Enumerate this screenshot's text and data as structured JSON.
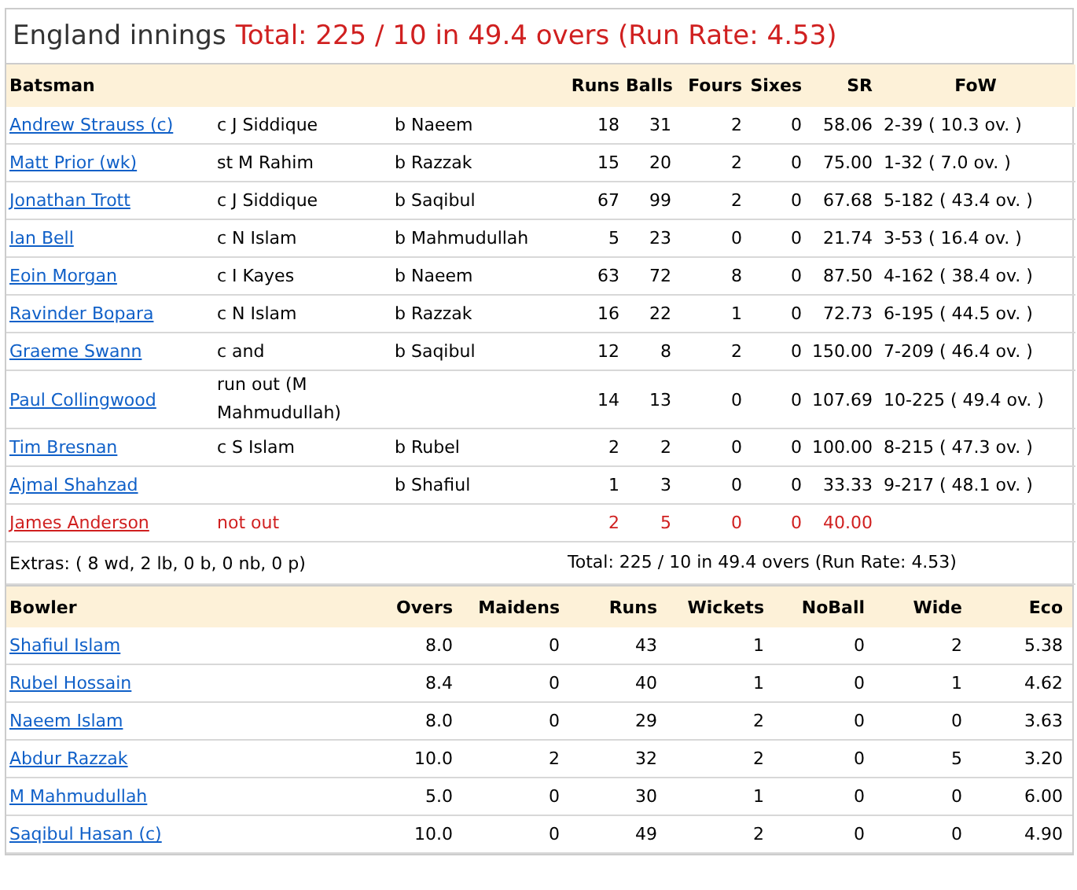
{
  "innings": {
    "team": "England innings",
    "total": "Total: 225 / 10 in 49.4 overs (Run Rate: 4.53)"
  },
  "batting": {
    "columns": [
      "Batsman",
      "Runs",
      "Balls",
      "Fours",
      "Sixes",
      "SR",
      "FoW"
    ],
    "rows": [
      {
        "name": "Andrew Strauss (c)",
        "dismissal": "c J Siddique",
        "bowler": "b Naeem",
        "runs": "18",
        "balls": "31",
        "fours": "2",
        "sixes": "0",
        "sr": "58.06",
        "fow": "2-39 ( 10.3 ov. )",
        "not_out": false
      },
      {
        "name": "Matt Prior (wk)",
        "dismissal": "st M Rahim",
        "bowler": "b Razzak",
        "runs": "15",
        "balls": "20",
        "fours": "2",
        "sixes": "0",
        "sr": "75.00",
        "fow": "1-32 ( 7.0 ov. )",
        "not_out": false
      },
      {
        "name": "Jonathan Trott",
        "dismissal": "c J Siddique",
        "bowler": "b Saqibul",
        "runs": "67",
        "balls": "99",
        "fours": "2",
        "sixes": "0",
        "sr": "67.68",
        "fow": "5-182 ( 43.4 ov. )",
        "not_out": false
      },
      {
        "name": "Ian Bell",
        "dismissal": "c N Islam",
        "bowler": "b Mahmudullah",
        "runs": "5",
        "balls": "23",
        "fours": "0",
        "sixes": "0",
        "sr": "21.74",
        "fow": "3-53 ( 16.4 ov. )",
        "not_out": false
      },
      {
        "name": "Eoin Morgan",
        "dismissal": "c I Kayes",
        "bowler": "b Naeem",
        "runs": "63",
        "balls": "72",
        "fours": "8",
        "sixes": "0",
        "sr": "87.50",
        "fow": "4-162 ( 38.4 ov. )",
        "not_out": false
      },
      {
        "name": "Ravinder Bopara",
        "dismissal": "c N Islam",
        "bowler": "b Razzak",
        "runs": "16",
        "balls": "22",
        "fours": "1",
        "sixes": "0",
        "sr": "72.73",
        "fow": "6-195 ( 44.5 ov. )",
        "not_out": false
      },
      {
        "name": "Graeme Swann",
        "dismissal": "c and",
        "bowler": "b Saqibul",
        "runs": "12",
        "balls": "8",
        "fours": "2",
        "sixes": "0",
        "sr": "150.00",
        "fow": "7-209 ( 46.4 ov. )",
        "not_out": false
      },
      {
        "name": "Paul Collingwood",
        "dismissal": "run out (M Mahmudullah)",
        "runs": "14",
        "balls": "13",
        "fours": "0",
        "sixes": "0",
        "sr": "107.69",
        "fow": "10-225 ( 49.4 ov. )",
        "not_out": false
      },
      {
        "name": "Tim Bresnan",
        "dismissal": "c S Islam",
        "bowler": "b Rubel",
        "runs": "2",
        "balls": "2",
        "fours": "0",
        "sixes": "0",
        "sr": "100.00",
        "fow": "8-215 ( 47.3 ov. )",
        "not_out": false
      },
      {
        "name": "Ajmal Shahzad",
        "bowler": "b Shafiul",
        "runs": "1",
        "balls": "3",
        "fours": "0",
        "sixes": "0",
        "sr": "33.33",
        "fow": "9-217 ( 48.1 ov. )",
        "not_out": false
      },
      {
        "name": "James Anderson",
        "dismissal": "not out",
        "runs": "2",
        "balls": "5",
        "fours": "0",
        "sixes": "0",
        "sr": "40.00",
        "not_out": true
      }
    ],
    "extras": "Extras: ( 8 wd, 2 lb, 0 b, 0 nb, 0 p)",
    "total": "Total: 225 / 10 in 49.4 overs (Run Rate: 4.53)"
  },
  "bowling": {
    "columns": [
      "Bowler",
      "Overs",
      "Maidens",
      "Runs",
      "Wickets",
      "NoBall",
      "Wide",
      "Eco"
    ],
    "rows": [
      [
        "Shafiul Islam",
        "8.0",
        "0",
        "43",
        "1",
        "0",
        "2",
        "5.38"
      ],
      [
        "Rubel Hossain",
        "8.4",
        "0",
        "40",
        "1",
        "0",
        "1",
        "4.62"
      ],
      [
        "Naeem Islam",
        "8.0",
        "0",
        "29",
        "2",
        "0",
        "0",
        "3.63"
      ],
      [
        "Abdur Razzak",
        "10.0",
        "2",
        "32",
        "2",
        "0",
        "5",
        "3.20"
      ],
      [
        "M Mahmudullah",
        "5.0",
        "0",
        "30",
        "1",
        "0",
        "0",
        "6.00"
      ],
      [
        "Saqibul Hasan (c)",
        "10.0",
        "0",
        "49",
        "2",
        "0",
        "0",
        "4.90"
      ]
    ]
  }
}
